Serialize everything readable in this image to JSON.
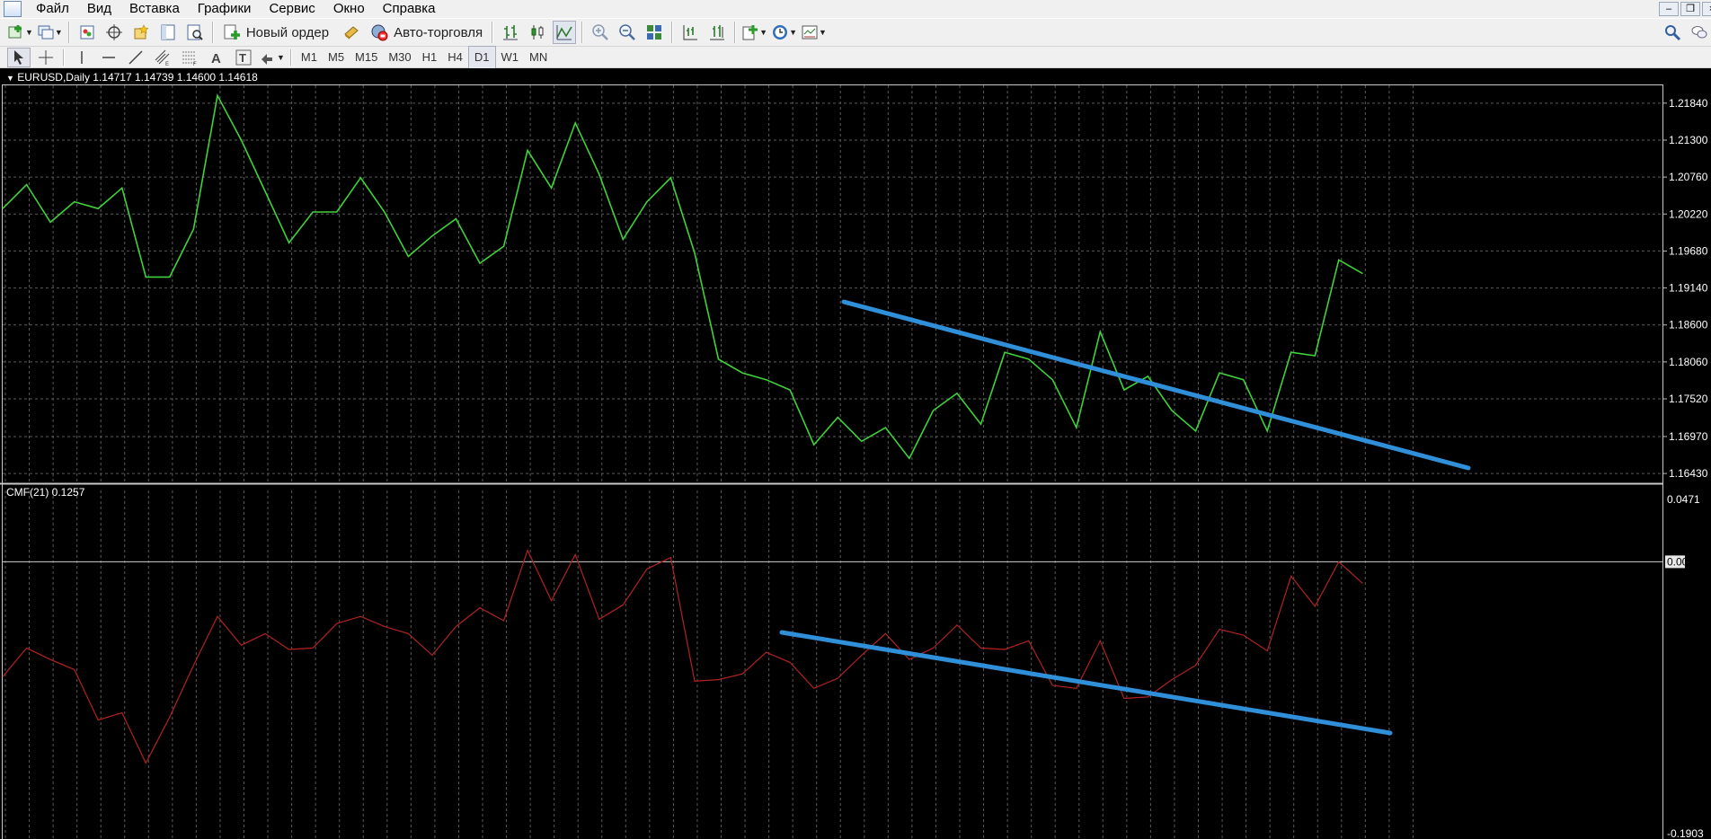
{
  "menu": {
    "items": [
      "Файл",
      "Вид",
      "Вставка",
      "Графики",
      "Сервис",
      "Окно",
      "Справка"
    ]
  },
  "toolbar1": {
    "new_order_label": "Новый ордер",
    "autotrading_label": "Авто-торговля"
  },
  "timeframes": [
    "M1",
    "M5",
    "M15",
    "M30",
    "H1",
    "H4",
    "D1",
    "W1",
    "MN"
  ],
  "active_timeframe": "D1",
  "chart": {
    "header": "EURUSD,Daily  1.14717 1.14739 1.14600 1.14618",
    "price_ticks": [
      "1.21840",
      "1.21300",
      "1.20760",
      "1.20220",
      "1.19680",
      "1.19140",
      "1.18600",
      "1.18060",
      "1.17520",
      "1.16970",
      "1.16430"
    ],
    "indicator_header": "CMF(21) 0.1257",
    "indicator_ticks": [
      "0.0471",
      "0.00",
      "-0.1903"
    ]
  },
  "chart_data": [
    {
      "type": "line",
      "title": "EURUSD,Daily",
      "color": "#3fd23a",
      "ylim": [
        1.163,
        1.221
      ],
      "values": [
        1.203,
        1.2065,
        1.201,
        1.204,
        1.203,
        1.206,
        1.193,
        1.193,
        1.2,
        1.2195,
        1.213,
        1.2055,
        1.198,
        1.2025,
        1.2025,
        1.2075,
        1.2025,
        1.196,
        1.199,
        1.2015,
        1.195,
        1.1975,
        1.2115,
        1.206,
        1.2155,
        1.208,
        1.1985,
        1.204,
        1.2075,
        1.1965,
        1.181,
        1.179,
        1.178,
        1.1765,
        1.1685,
        1.1725,
        1.169,
        1.171,
        1.1665,
        1.1735,
        1.176,
        1.1715,
        1.182,
        1.181,
        1.178,
        1.171,
        1.185,
        1.1765,
        1.1785,
        1.1735,
        1.1705,
        1.179,
        1.178,
        1.1705,
        1.182,
        1.1815,
        1.1955,
        1.1935
      ]
    },
    {
      "type": "line",
      "title": "CMF(21)",
      "color": "#b22222",
      "ylim": [
        -0.1903,
        0.0471
      ],
      "values": [
        -0.08,
        -0.06,
        -0.068,
        -0.075,
        -0.11,
        -0.105,
        -0.14,
        -0.108,
        -0.072,
        -0.038,
        -0.058,
        -0.05,
        -0.061,
        -0.06,
        -0.043,
        -0.038,
        -0.045,
        -0.05,
        -0.065,
        -0.045,
        -0.032,
        -0.041,
        0.008,
        -0.027,
        0.005,
        -0.04,
        -0.03,
        -0.005,
        0.003,
        -0.083,
        -0.082,
        -0.078,
        -0.063,
        -0.07,
        -0.088,
        -0.081,
        -0.065,
        -0.05,
        -0.068,
        -0.06,
        -0.044,
        -0.06,
        -0.061,
        -0.055,
        -0.086,
        -0.088,
        -0.055,
        -0.095,
        -0.094,
        -0.082,
        -0.072,
        -0.047,
        -0.051,
        -0.062,
        -0.01,
        -0.031,
        0.0,
        -0.015
      ]
    }
  ],
  "trendlines": {
    "color": "#2f8fd8"
  }
}
